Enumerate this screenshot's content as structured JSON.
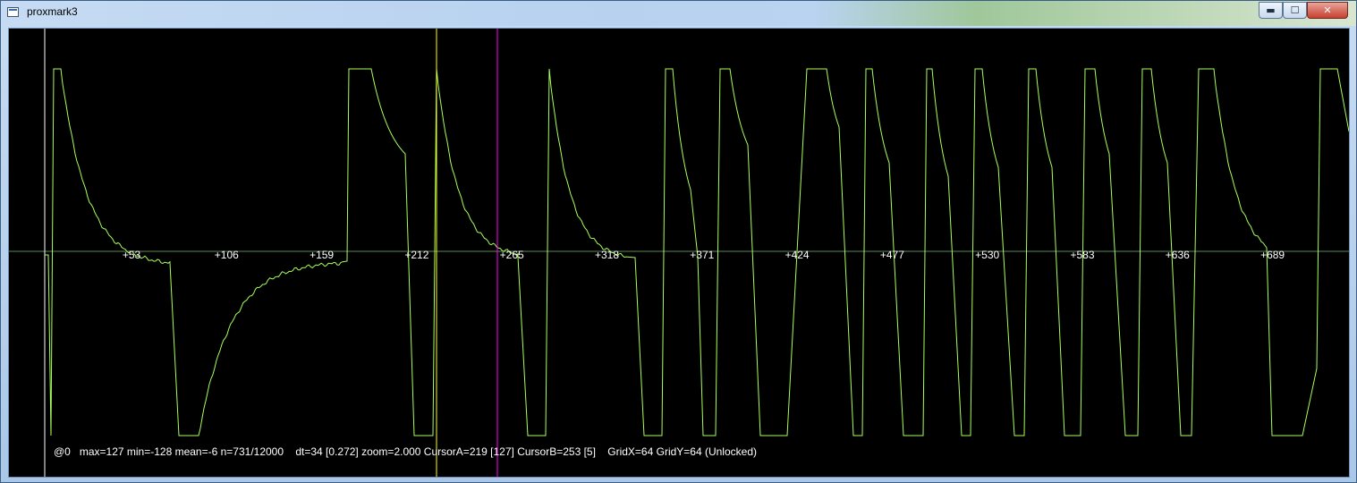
{
  "window": {
    "title": "proxmark3",
    "controls": {
      "minimize": "▬",
      "maximize": "☐",
      "close": "✕"
    }
  },
  "plot": {
    "colors": {
      "background": "#000000",
      "trace": "#a7ff5a",
      "axis": "#5a8a5a",
      "cursor_a": "#ffff00",
      "cursor_b": "#ff00ff",
      "origin_line": "#ffffff"
    },
    "tick_labels": [
      "+53",
      "+106",
      "+159",
      "+212",
      "+265",
      "+318",
      "+371",
      "+424",
      "+477",
      "+530",
      "+583",
      "+636",
      "+689"
    ],
    "status_text": "@0   max=127 min=-128 mean=-6 n=731/12000    dt=34 [0.272] zoom=2.000 CursorA=219 [127] CursorB=253 [5]    GridX=64 GridY=64 (Unlocked)"
  }
}
